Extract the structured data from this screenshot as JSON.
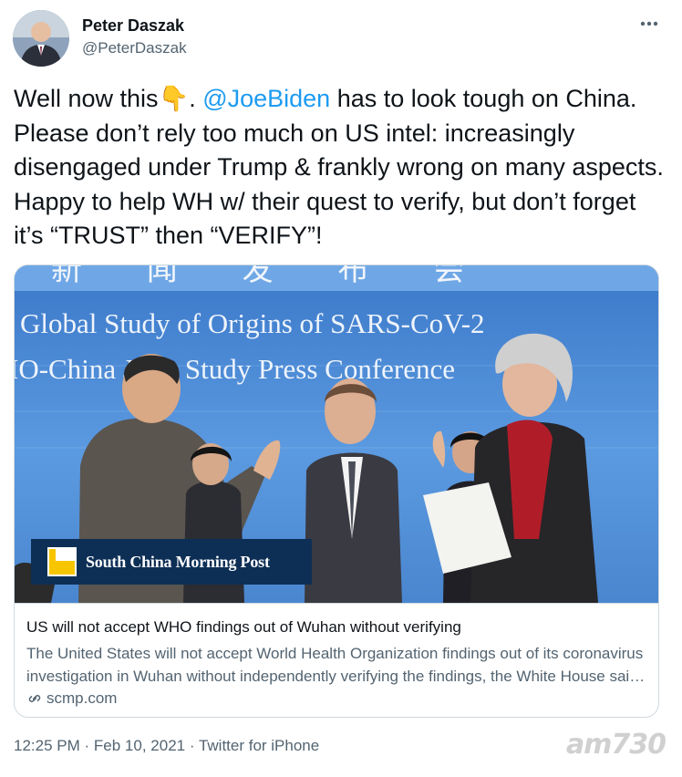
{
  "author": {
    "display_name": "Peter Daszak",
    "handle": "@PeterDaszak"
  },
  "tweet": {
    "text_before_emoji": "Well now this",
    "emoji": "👇",
    "text_after_emoji": ". ",
    "mention": "@JoeBiden",
    "text_rest": " has to look tough on China. Please don’t rely too much on US intel: increasingly disengaged under Trump & frankly wrong on many aspects. Happy to help WH w/ their quest to verify, but don’t forget it’s “TRUST” then “VERIFY”!"
  },
  "card": {
    "image_banner_line1": "Global Study of Origins of SARS-CoV-2",
    "image_banner_line2": "IO-China Joint Study Press Conference",
    "image_banner_top": "新 闻 发 布 会",
    "publisher_badge": "South China Morning Post",
    "title": "US will not accept WHO findings out of Wuhan without verifying",
    "description": "The United States will not accept World Health Organization findings out of its coronavirus investigation in Wuhan without independently verifying the findings, the White House said on Tuesday.",
    "domain": "scmp.com"
  },
  "meta": {
    "time": "12:25 PM",
    "separator": "·",
    "date": "Feb 10, 2021",
    "source": "Twitter for iPhone"
  },
  "watermark": "am730",
  "colors": {
    "link": "#1d9bf0",
    "secondary_text": "#536471",
    "scmp_navy": "#0e2f55",
    "scmp_yellow": "#f7c600"
  }
}
